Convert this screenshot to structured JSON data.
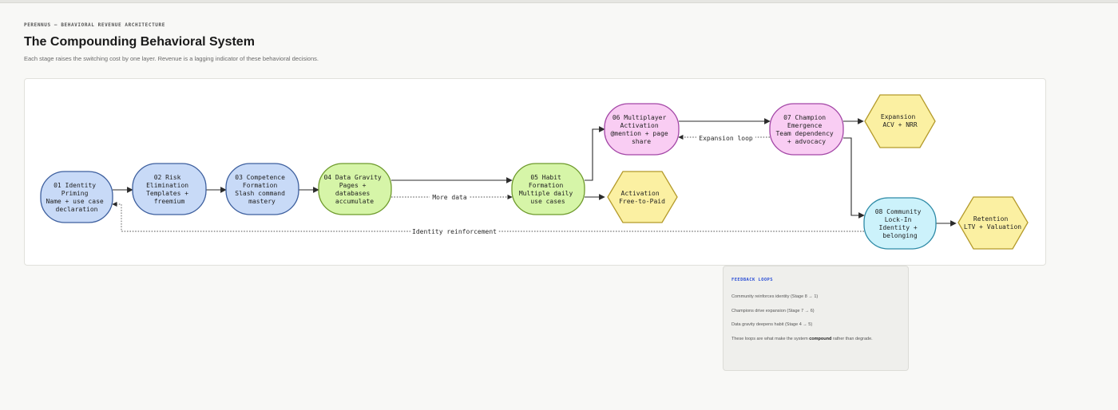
{
  "header": {
    "kicker": "PERENNUS — BEHAVIORAL REVENUE ARCHITECTURE",
    "title": "The Compounding Behavioral System",
    "subtitle": "Each stage raises the switching cost by one layer. Revenue is a lagging indicator of these behavioral decisions."
  },
  "colors": {
    "identity_blue": "#c8daf7",
    "blue_stroke": "#3d5f9e",
    "habit_green": "#d6f5a8",
    "green_stroke": "#6e9a2c",
    "multiplayer_pink": "#f9cdf3",
    "pink_stroke": "#a346a6",
    "community_cyan": "#ccf2fb",
    "cyan_stroke": "#2d8aa6",
    "outcome_yellow": "#fbf0a2",
    "yellow_stroke": "#b49a2a"
  },
  "diagram": {
    "nodes": [
      {
        "id": "n1",
        "lines": [
          "01 Identity",
          "Priming",
          "Name + use case",
          "declaration"
        ]
      },
      {
        "id": "n2",
        "lines": [
          "02 Risk",
          "Elimination",
          "Templates +",
          "freemium"
        ]
      },
      {
        "id": "n3",
        "lines": [
          "03 Competence",
          "Formation",
          "Slash command",
          "mastery"
        ]
      },
      {
        "id": "n4",
        "lines": [
          "04 Data Gravity",
          "Pages +",
          "databases",
          "accumulate"
        ]
      },
      {
        "id": "n5",
        "lines": [
          "05 Habit",
          "Formation",
          "Multiple daily",
          "use cases"
        ]
      },
      {
        "id": "n6",
        "lines": [
          "06 Multiplayer",
          "Activation",
          "@mention + page",
          "share"
        ]
      },
      {
        "id": "n7",
        "lines": [
          "07 Champion",
          "Emergence",
          "Team dependency",
          "+ advocacy"
        ]
      },
      {
        "id": "n8",
        "lines": [
          "08 Community",
          "Lock-In",
          "Identity +",
          "belonging"
        ]
      },
      {
        "id": "o1",
        "lines": [
          "Activation",
          "Free-to-Paid"
        ]
      },
      {
        "id": "o2",
        "lines": [
          "Expansion",
          "ACV + NRR"
        ]
      },
      {
        "id": "o3",
        "lines": [
          "Retention",
          "LTV + Valuation"
        ]
      }
    ],
    "edge_labels": {
      "more_data": "More data",
      "expansion_loop": "Expansion loop",
      "identity_reinforcement": "Identity reinforcement"
    }
  },
  "feedback": {
    "heading": "FEEDBACK LOOPS",
    "items": [
      "Community reinforces identity (Stage 8 → 1)",
      "Champions drive expansion (Stage 7 → 6)",
      "Data gravity deepens habit (Stage 4 → 5)"
    ],
    "note_before": "These loops are what make the system ",
    "note_bold": "compound",
    "note_after": " rather than degrade."
  }
}
